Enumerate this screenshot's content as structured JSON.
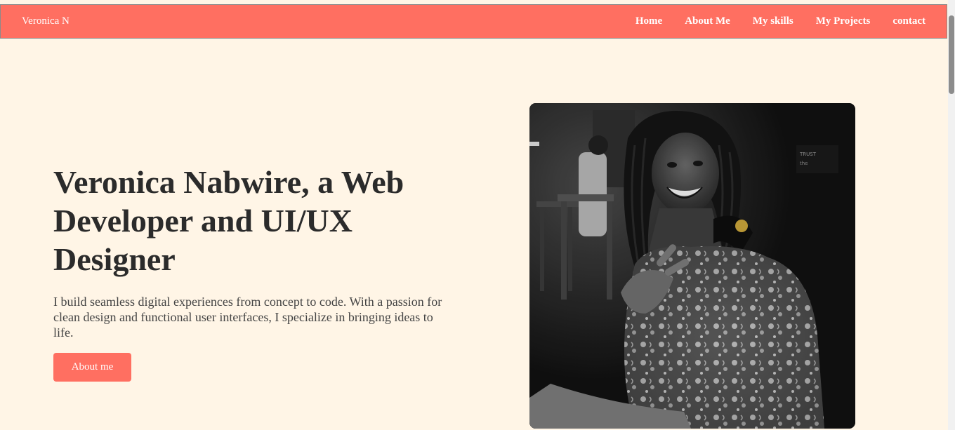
{
  "nav": {
    "brand": "Veronica N",
    "links": [
      "Home",
      "About Me",
      "My skills",
      "My Projects",
      "contact"
    ]
  },
  "hero": {
    "title": "Veronica Nabwire, a Web Developer and UI/UX Designer",
    "description": "I build seamless digital experiences from concept to code. With a passion for clean design and functional user interfaces, I specialize in bringing ideas to life.",
    "button_label": "About me"
  },
  "colors": {
    "accent": "#FF6F61",
    "background": "#FFF5E6",
    "heading": "#2b2b2b"
  }
}
